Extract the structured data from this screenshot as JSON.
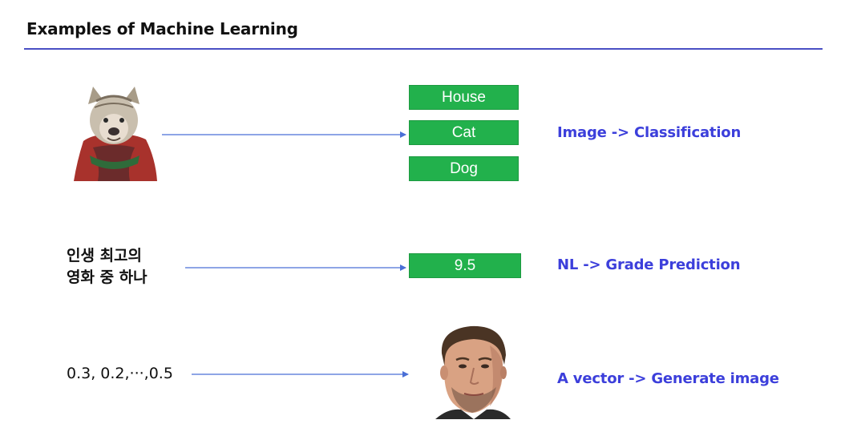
{
  "title": "Examples of Machine Learning",
  "rows": [
    {
      "input_icon": "dog-in-costume-icon",
      "outputs": [
        "House",
        "Cat",
        "Dog"
      ],
      "description": "Image -> Classification"
    },
    {
      "input_line1": "인생 최고의",
      "input_line2": "영화 중 하나",
      "outputs": [
        "9.5"
      ],
      "description": "NL -> Grade Prediction"
    },
    {
      "input_text": "0.3, 0.2,···,0.5",
      "output_icon": "man-face-icon",
      "description": "A vector -> Generate image"
    }
  ],
  "colors": {
    "accent": "#3c3fdb",
    "rule": "#4a4fc4",
    "box": "#22b14c"
  }
}
